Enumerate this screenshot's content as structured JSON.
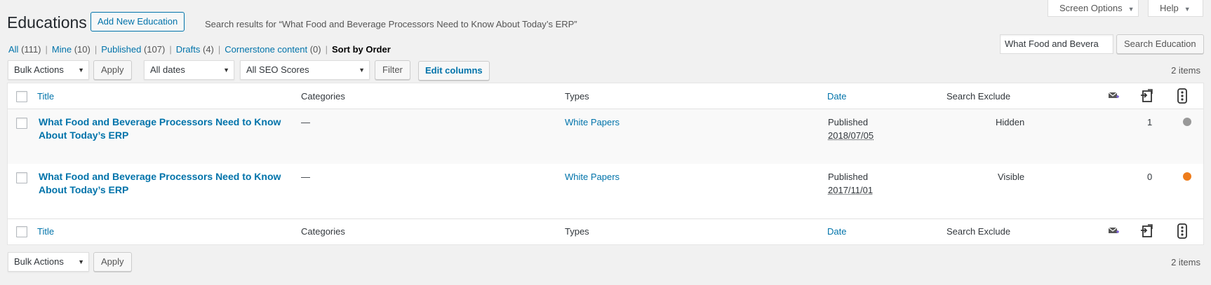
{
  "screen_tabs": {
    "screen_options": "Screen Options",
    "help": "Help"
  },
  "header": {
    "title": "Educations",
    "add_new": "Add New Education",
    "search_results": "Search results for “What Food and Beverage Processors Need to Know About Today’s ERP”"
  },
  "filters": {
    "all": "All",
    "all_count": "(111)",
    "mine": "Mine",
    "mine_count": "(10)",
    "published": "Published",
    "published_count": "(107)",
    "drafts": "Drafts",
    "drafts_count": "(4)",
    "cornerstone": "Cornerstone content",
    "cornerstone_count": "(0)",
    "sort_by_order": "Sort by Order"
  },
  "search": {
    "value": "What Food and Bevera",
    "button": "Search Education"
  },
  "toolbar_top": {
    "bulk_actions": "Bulk Actions",
    "apply": "Apply",
    "all_dates": "All dates",
    "seo_scores": "All SEO Scores",
    "filter": "Filter",
    "edit_columns": "Edit columns",
    "items_count": "2 items"
  },
  "columns": {
    "title": "Title",
    "categories": "Categories",
    "types": "Types",
    "date": "Date",
    "search_exclude": "Search Exclude"
  },
  "rows": [
    {
      "title_line1": "What Food and Beverage Processors Need to Know",
      "title_line2": "About Today’s ERP",
      "categories": "—",
      "types": "White Papers",
      "status": "Published",
      "date": "2018/07/05",
      "search_exclude": "Hidden",
      "count": "1",
      "seo_color": "#999999"
    },
    {
      "title_line1": "What Food and Beverage Processors Need to Know",
      "title_line2": "About Today’s ERP",
      "categories": "—",
      "types": "White Papers",
      "status": "Published",
      "date": "2017/11/01",
      "search_exclude": "Visible",
      "count": "0",
      "seo_color": "#ee7c1b"
    }
  ],
  "toolbar_bottom": {
    "bulk_actions": "Bulk Actions",
    "apply": "Apply",
    "items_count": "2 items"
  }
}
